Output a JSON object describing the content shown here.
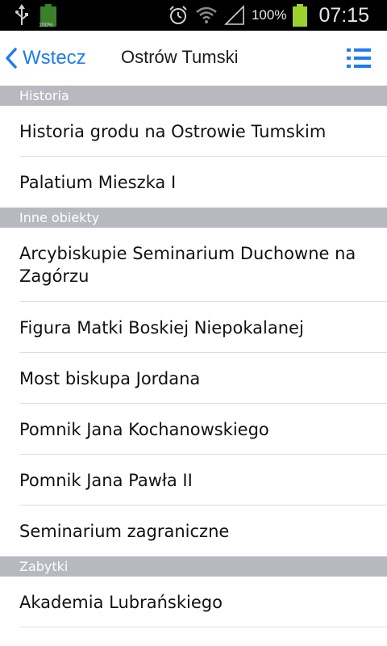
{
  "status_bar": {
    "mini_battery_label": "100%",
    "battery_percent": "100%",
    "time": "07:15"
  },
  "header": {
    "back_label": "Wstecz",
    "title": "Ostrów Tumski"
  },
  "sections": [
    {
      "header": "Historia",
      "items": [
        "Historia grodu na Ostrowie Tumskim",
        "Palatium Mieszka I"
      ]
    },
    {
      "header": "Inne obiekty",
      "items": [
        "Arcybiskupie Seminarium Duchowne na Zagórzu",
        "Figura Matki Boskiej Niepokalanej",
        "Most biskupa Jordana",
        "Pomnik Jana Kochanowskiego",
        "Pomnik Jana Pawła II",
        "Seminarium zagraniczne"
      ]
    },
    {
      "header": "Zabytki",
      "items": [
        "Akademia Lubrańskiego"
      ]
    }
  ],
  "colors": {
    "accent": "#1e7cf0",
    "section_bg": "#b8b9c0",
    "battery": "#9fd12c"
  }
}
